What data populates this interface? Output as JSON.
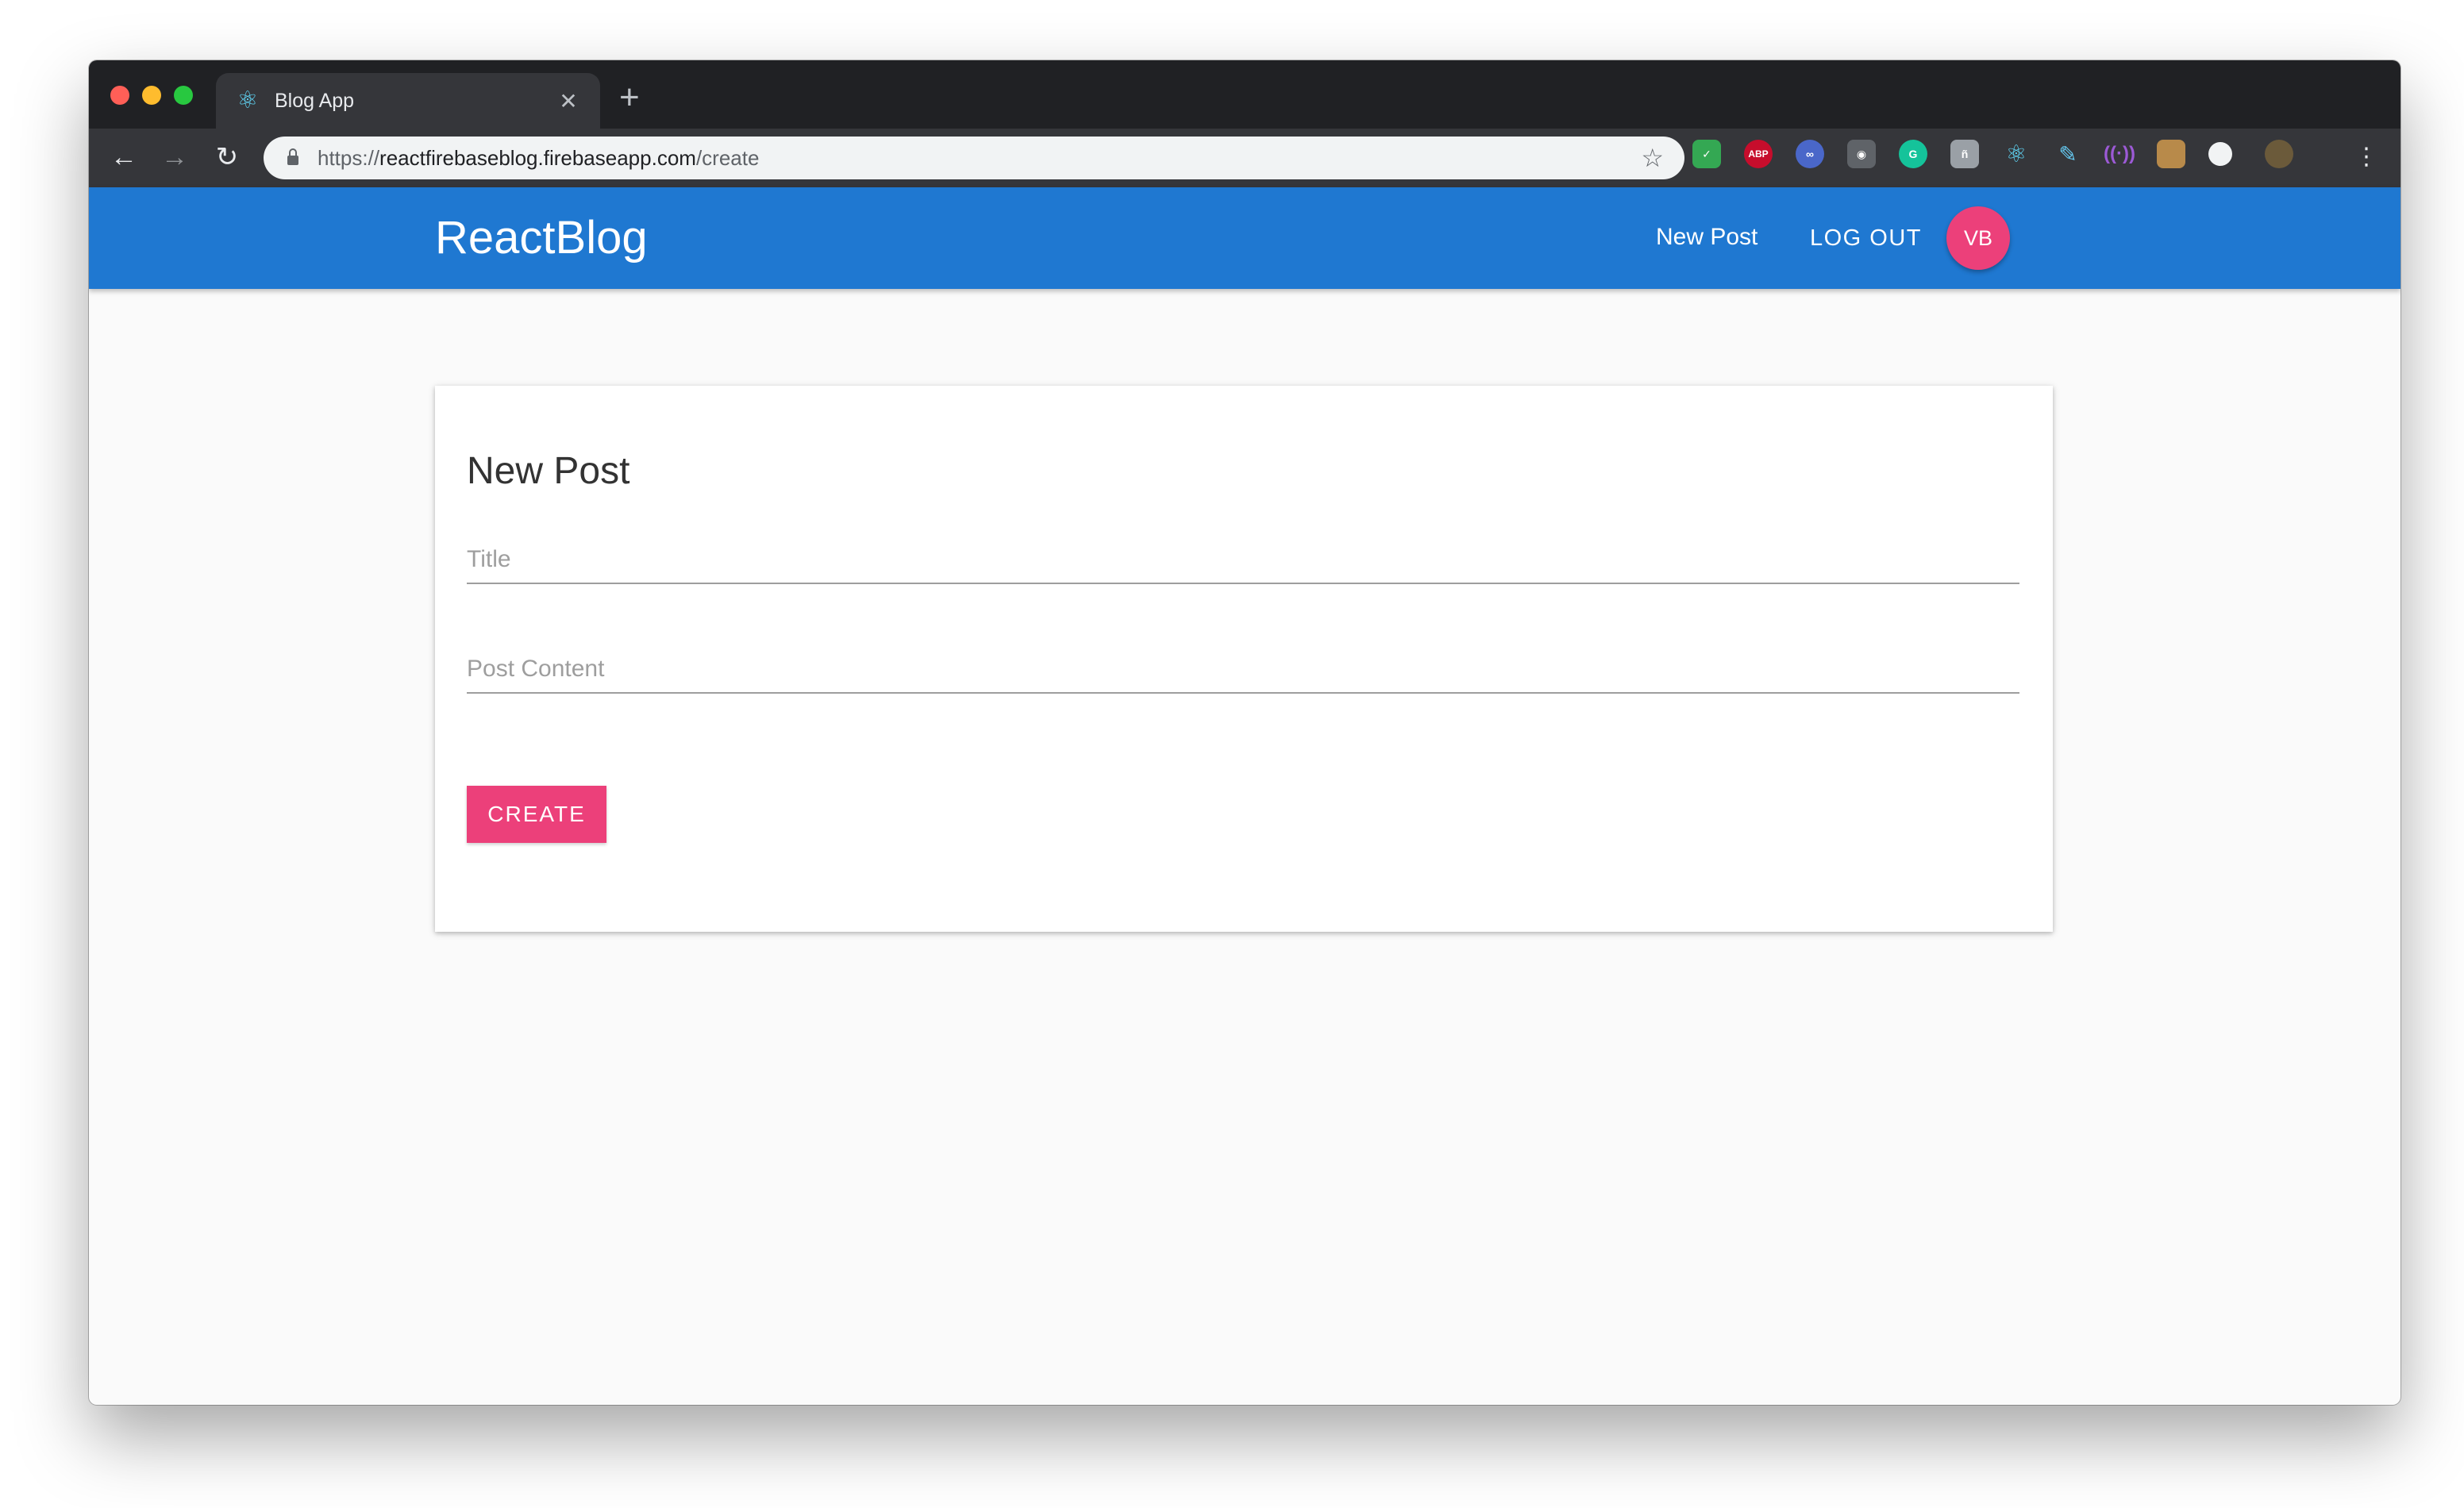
{
  "browser": {
    "tab_title": "Blog App",
    "tab_icon": "react-icon",
    "url_prefix": "https://",
    "url_host": "reactfirebaseblog.firebaseapp.com",
    "url_path": "/create",
    "extensions": [
      {
        "icon": "shield-check-icon",
        "color": "#34a853"
      },
      {
        "icon": "abp-icon",
        "label": "ABP",
        "color": "#c70d2c"
      },
      {
        "icon": "extension-icon",
        "color": "#4a67c9"
      },
      {
        "icon": "camera-icon",
        "color": "#5f6368"
      },
      {
        "icon": "grammarly-icon",
        "color": "#15c39a"
      },
      {
        "icon": "font-icon",
        "color": "#9aa0a6"
      },
      {
        "icon": "react-devtools-icon",
        "color": "#61dafb"
      },
      {
        "icon": "pen-icon",
        "color": "#64c8f0"
      },
      {
        "icon": "broadcast-icon",
        "color": "#9c5ad6"
      },
      {
        "icon": "box-icon",
        "color": "#b88a4a"
      },
      {
        "icon": "circle-icon",
        "color": "#f1f3f4"
      }
    ]
  },
  "app": {
    "brand": "ReactBlog",
    "nav_new_post": "New Post",
    "nav_logout": "LOG OUT",
    "avatar_initials": "VB",
    "primary_color": "#1f78d1",
    "accent_color": "#ec407a"
  },
  "form": {
    "heading": "New Post",
    "title_placeholder": "Title",
    "content_placeholder": "Post Content",
    "create_label": "CREATE"
  }
}
